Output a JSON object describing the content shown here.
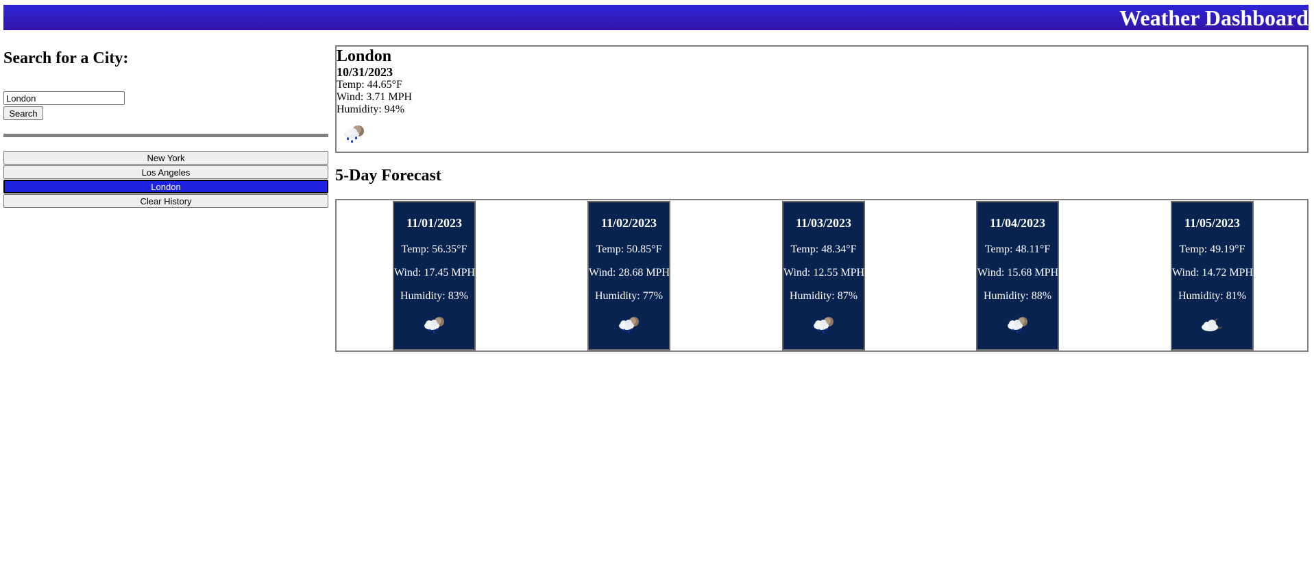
{
  "header": {
    "title": "Weather Dashboard"
  },
  "search": {
    "heading": "Search for a City:",
    "input_value": "London",
    "button_label": "Search"
  },
  "history": {
    "items": [
      {
        "label": "New York",
        "active": false
      },
      {
        "label": "Los Angeles",
        "active": false
      },
      {
        "label": "London",
        "active": true
      }
    ],
    "clear_label": "Clear History"
  },
  "current": {
    "city": "London",
    "date": "10/31/2023",
    "temp": "Temp: 44.65°F",
    "wind": "Wind: 3.71 MPH",
    "humidity": "Humidity: 94%",
    "icon": "rain-cloud-moon-icon"
  },
  "forecast": {
    "title": "5-Day Forecast",
    "days": [
      {
        "date": "11/01/2023",
        "temp": "Temp: 56.35°F",
        "wind": "Wind: 17.45 MPH",
        "humidity": "Humidity: 83%",
        "icon": "rain-cloud-moon-icon"
      },
      {
        "date": "11/02/2023",
        "temp": "Temp: 50.85°F",
        "wind": "Wind: 28.68 MPH",
        "humidity": "Humidity: 77%",
        "icon": "rain-cloud-moon-icon"
      },
      {
        "date": "11/03/2023",
        "temp": "Temp: 48.34°F",
        "wind": "Wind: 12.55 MPH",
        "humidity": "Humidity: 87%",
        "icon": "rain-cloud-moon-icon"
      },
      {
        "date": "11/04/2023",
        "temp": "Temp: 48.11°F",
        "wind": "Wind: 15.68 MPH",
        "humidity": "Humidity: 88%",
        "icon": "rain-cloud-moon-icon"
      },
      {
        "date": "11/05/2023",
        "temp": "Temp: 49.19°F",
        "wind": "Wind: 14.72 MPH",
        "humidity": "Humidity: 81%",
        "icon": "cloud-moon-icon"
      }
    ]
  },
  "colors": {
    "header_bg": "#2c26d6",
    "active_history": "#1f23e0",
    "card_bg": "#08234f"
  }
}
